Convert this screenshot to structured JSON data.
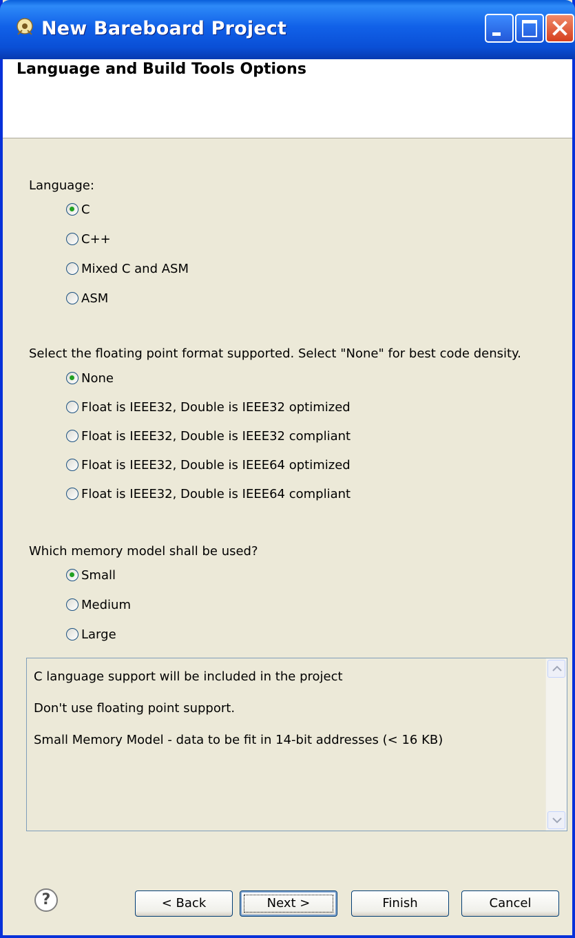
{
  "window": {
    "title": "New Bareboard Project"
  },
  "banner": {
    "title": "Language and Build Tools Options"
  },
  "language": {
    "label": "Language:",
    "options": [
      {
        "label": "C",
        "checked": true
      },
      {
        "label": "C++",
        "checked": false
      },
      {
        "label": "Mixed C and ASM",
        "checked": false
      },
      {
        "label": "ASM",
        "checked": false
      }
    ]
  },
  "floating": {
    "label": "Select the floating point format supported. Select \"None\" for best code density.",
    "options": [
      {
        "label": "None",
        "checked": true
      },
      {
        "label": "Float is IEEE32, Double is IEEE32 optimized",
        "checked": false
      },
      {
        "label": "Float is IEEE32, Double is IEEE32 compliant",
        "checked": false
      },
      {
        "label": "Float is IEEE32, Double is IEEE64 optimized",
        "checked": false
      },
      {
        "label": "Float is IEEE32, Double is IEEE64 compliant",
        "checked": false
      }
    ]
  },
  "memory": {
    "label": "Which memory model shall be used?",
    "options": [
      {
        "label": "Small",
        "checked": true
      },
      {
        "label": "Medium",
        "checked": false
      },
      {
        "label": "Large",
        "checked": false
      }
    ]
  },
  "description": {
    "lines": [
      "C language support will be included in the project",
      "Don't use floating point support.",
      "Small Memory Model - data to be fit in 14-bit addresses (< 16 KB)"
    ]
  },
  "buttons": {
    "help": "?",
    "back": "< Back",
    "next": "Next >",
    "finish": "Finish",
    "cancel": "Cancel"
  },
  "icons": {
    "app": "app-icon",
    "help": "help-icon",
    "minimize": "minimize-icon",
    "maximize": "maximize-icon",
    "close": "close-icon"
  }
}
